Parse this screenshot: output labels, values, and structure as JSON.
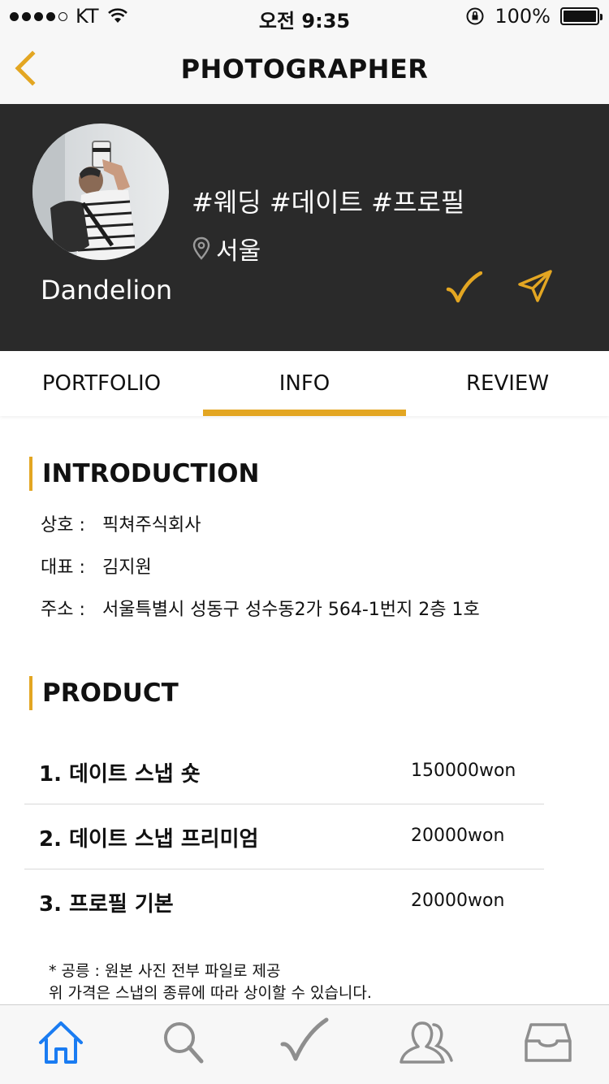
{
  "status_bar": {
    "carrier": "KT",
    "time": "오전 9:35",
    "battery": "100%",
    "battery_level": 1.0
  },
  "nav": {
    "title": "PHOTOGRAPHER",
    "back_icon": "chevron-left-icon"
  },
  "profile": {
    "name": "Dandelion",
    "hashtags": "#웨딩 #데이트 #프로필",
    "location": "서울",
    "accent_color": "#e3a622"
  },
  "tabs": [
    {
      "label": "PORTFOLIO"
    },
    {
      "label": "INFO",
      "active": true
    },
    {
      "label": "REVIEW"
    }
  ],
  "introduction": {
    "heading": "INTRODUCTION",
    "rows": [
      {
        "key": "상호 :",
        "value": "픽쳐주식회사"
      },
      {
        "key": "대표 :",
        "value": "김지원"
      },
      {
        "key": "주소 :",
        "value": "서울특별시 성동구 성수동2가 564-1번지 2층 1호"
      }
    ]
  },
  "product": {
    "heading": "PRODUCT",
    "items": [
      {
        "name": "1. 데이트 스냅 숏",
        "price": "150000won"
      },
      {
        "name": "2. 데이트 스냅 프리미엄",
        "price": "20000won"
      },
      {
        "name": "3. 프로필 기본",
        "price": "20000won"
      }
    ],
    "note_line1": "* 공릉 : 원본 사진 전부 파일로 제공",
    "note_line2": "위 가격은 스냅의 종류에 따라 상이할 수 있습니다."
  },
  "tabbar": {
    "items": [
      "home-icon",
      "search-icon",
      "check-icon",
      "users-icon",
      "inbox-icon"
    ],
    "active_color": "#1a7cf2",
    "inactive_color": "#8e8e8e"
  }
}
